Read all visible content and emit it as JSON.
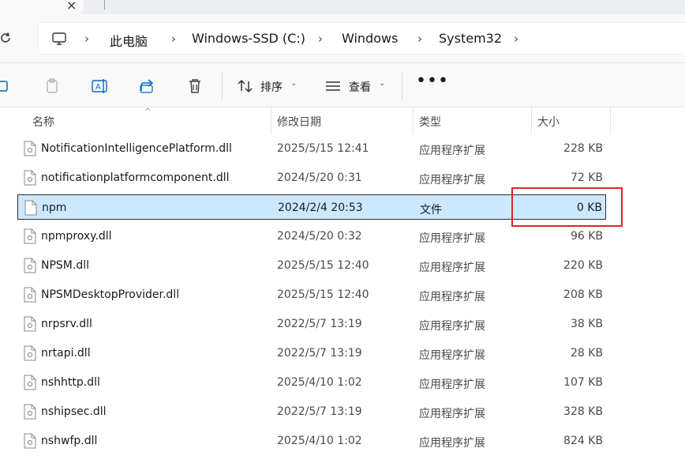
{
  "tab": {
    "close_glyph": "×"
  },
  "breadcrumb": {
    "items": [
      "此电脑",
      "Windows-SSD (C:)",
      "Windows",
      "System32"
    ]
  },
  "toolbar": {
    "sort_label": "排序",
    "view_label": "查看",
    "more_label": "•••"
  },
  "columns": {
    "name": "名称",
    "date": "修改日期",
    "type": "类型",
    "size": "大小"
  },
  "files": [
    {
      "name": "NotificationIntelligencePlatform.dll",
      "date": "2025/5/15 12:41",
      "type": "应用程序扩展",
      "size": "228 KB"
    },
    {
      "name": "notificationplatformcomponent.dll",
      "date": "2024/5/20 0:31",
      "type": "应用程序扩展",
      "size": "72 KB"
    },
    {
      "name": "npm",
      "date": "2024/2/4 20:53",
      "type": "文件",
      "size": "0 KB",
      "selected": true
    },
    {
      "name": "npmproxy.dll",
      "date": "2024/5/20 0:32",
      "type": "应用程序扩展",
      "size": "96 KB"
    },
    {
      "name": "NPSM.dll",
      "date": "2025/5/15 12:40",
      "type": "应用程序扩展",
      "size": "220 KB"
    },
    {
      "name": "NPSMDesktopProvider.dll",
      "date": "2025/5/15 12:40",
      "type": "应用程序扩展",
      "size": "208 KB"
    },
    {
      "name": "nrpsrv.dll",
      "date": "2022/5/7 13:19",
      "type": "应用程序扩展",
      "size": "38 KB"
    },
    {
      "name": "nrtapi.dll",
      "date": "2022/5/7 13:19",
      "type": "应用程序扩展",
      "size": "28 KB"
    },
    {
      "name": "nshhttp.dll",
      "date": "2025/4/10 1:02",
      "type": "应用程序扩展",
      "size": "107 KB"
    },
    {
      "name": "nshipsec.dll",
      "date": "2022/5/7 13:19",
      "type": "应用程序扩展",
      "size": "328 KB"
    },
    {
      "name": "nshwfp.dll",
      "date": "2025/4/10 1:02",
      "type": "应用程序扩展",
      "size": "824 KB"
    }
  ],
  "colors": {
    "selection_bg": "#cce8ff",
    "annotation_red": "#e0262b"
  },
  "icons": [
    "refresh-icon",
    "computer-icon",
    "copy-icon",
    "paste-icon",
    "rename-icon",
    "share-icon",
    "delete-icon",
    "sort-icon",
    "view-icon",
    "dll-file-icon",
    "blank-file-icon"
  ]
}
